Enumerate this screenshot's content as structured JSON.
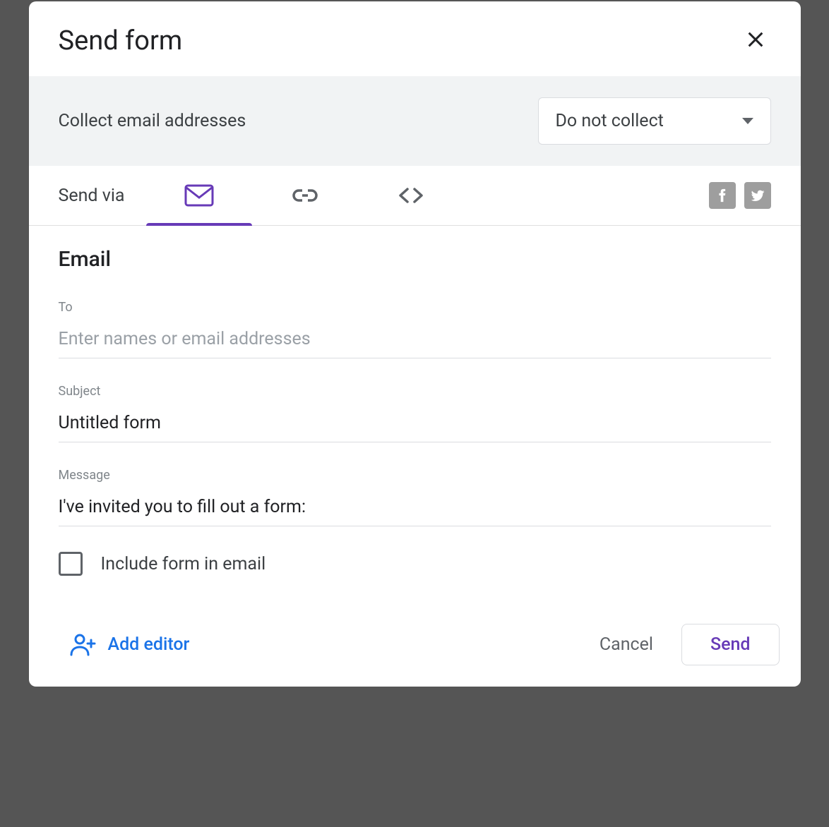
{
  "dialog": {
    "title": "Send form"
  },
  "collect": {
    "label": "Collect email addresses",
    "selected": "Do not collect"
  },
  "tabs": {
    "label": "Send via"
  },
  "email": {
    "section_title": "Email",
    "to_label": "To",
    "to_placeholder": "Enter names or email addresses",
    "to_value": "",
    "subject_label": "Subject",
    "subject_value": "Untitled form",
    "message_label": "Message",
    "message_value": "I've invited you to fill out a form:",
    "include_form_label": "Include form in email"
  },
  "footer": {
    "add_editor": "Add editor",
    "cancel": "Cancel",
    "send": "Send"
  }
}
